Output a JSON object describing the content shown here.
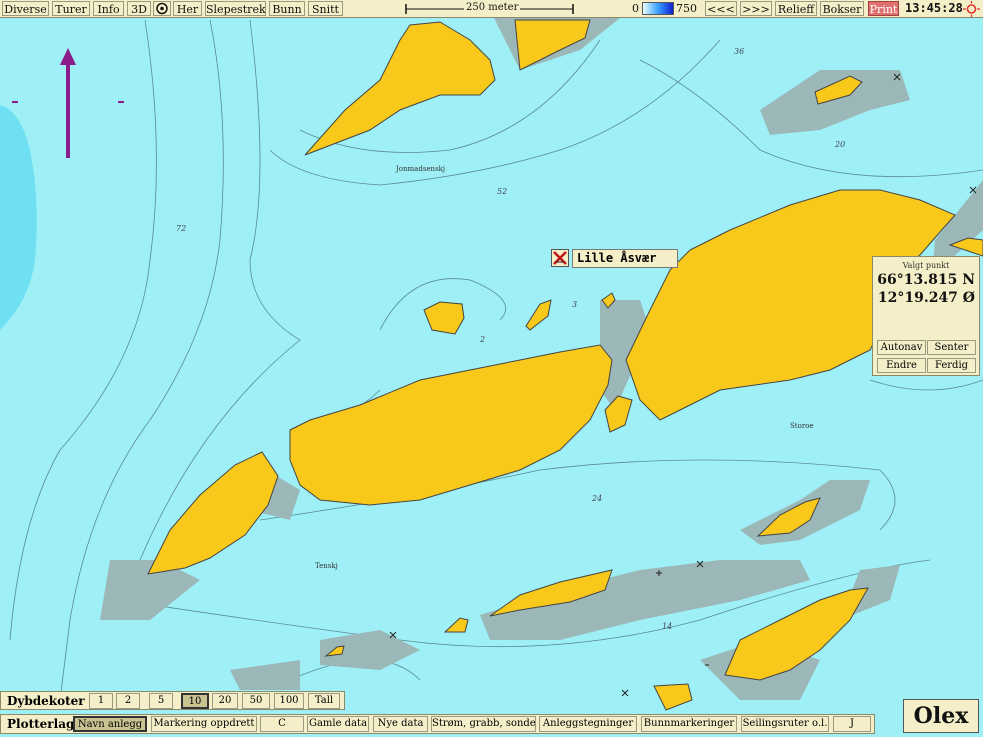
{
  "toolbar": {
    "diverse": "Diverse",
    "turer": "Turer",
    "info": "Info",
    "threed": "3D",
    "her": "Her",
    "slepestrek": "Slepestrek",
    "bunn": "Bunn",
    "snitt": "Snitt",
    "scale_label": "250 meter",
    "depth_min": "0",
    "depth_max": "750",
    "prev": "<<<",
    "next": ">>>",
    "relieff": "Relieff",
    "bokser": "Bokser",
    "print": "Print",
    "clock": "13:45:28"
  },
  "map": {
    "place_names": [
      "Jonmadsenskj",
      "Storoe",
      "Tenskj"
    ],
    "depth_labels": [
      "36",
      "20",
      "52",
      "72",
      "3",
      "2",
      "24",
      "14"
    ],
    "marker_name": "Lille Åsvær",
    "colors": {
      "sea": "#9ef0f6",
      "land": "#f8c81a",
      "shallow": "#9bb7b7",
      "deep": "#6ee0f2"
    }
  },
  "point_panel": {
    "title": "Valgt punkt",
    "lat": "66°13.815 N",
    "lon": "12°19.247 Ø",
    "autonav": "Autonav",
    "senter": "Senter",
    "endre": "Endre",
    "ferdig": "Ferdig"
  },
  "depth_bar": {
    "label": "Dybdekoter",
    "options": [
      "1",
      "2",
      "5",
      "10",
      "20",
      "50",
      "100",
      "Tall"
    ],
    "selected": "10"
  },
  "plot_bar": {
    "label": "Plotterlag",
    "layers": [
      "Navn anlegg",
      "Markering oppdrett",
      "C",
      "Gamle data",
      "Nye data",
      "Strøm, grabb, sonde",
      "Anleggstegninger",
      "Bunnmarkeringer",
      "Seilingsruter o.l.",
      "J"
    ],
    "selected": "Navn anlegg"
  },
  "brand": "Olex"
}
